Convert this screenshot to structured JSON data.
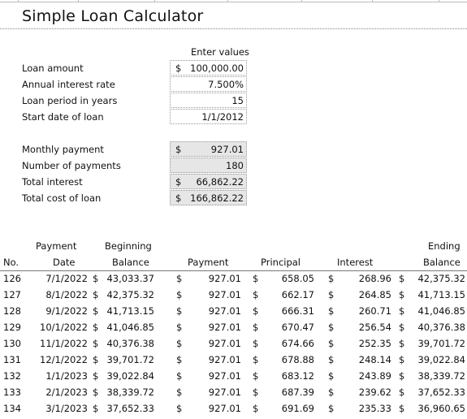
{
  "title": "Simple Loan Calculator",
  "inputs": {
    "header": "Enter values",
    "fields": [
      {
        "label": "Loan amount",
        "currency": "$",
        "value": "100,000.00"
      },
      {
        "label": "Annual interest rate",
        "currency": "",
        "value": "7.500%"
      },
      {
        "label": "Loan period in years",
        "currency": "",
        "value": "15"
      },
      {
        "label": "Start date of loan",
        "currency": "",
        "value": "1/1/2012"
      }
    ]
  },
  "results": {
    "fields": [
      {
        "label": "Monthly payment",
        "currency": "$",
        "value": "927.01"
      },
      {
        "label": "Number of payments",
        "currency": "",
        "value": "180"
      },
      {
        "label": "Total interest",
        "currency": "$",
        "value": "66,862.22"
      },
      {
        "label": "Total cost of loan",
        "currency": "$",
        "value": "166,862.22"
      }
    ]
  },
  "schedule": {
    "headers": {
      "no": "No.",
      "date_top": "Payment",
      "date": "Date",
      "beginning_top": "Beginning",
      "beginning": "Balance",
      "payment": "Payment",
      "principal": "Principal",
      "interest": "Interest",
      "ending_top": "Ending",
      "ending": "Balance"
    },
    "currency": "$",
    "rows": [
      {
        "no": "126",
        "date": "7/1/2022",
        "beginning": "43,033.37",
        "payment": "927.01",
        "principal": "658.05",
        "interest": "268.96",
        "ending": "42,375.32"
      },
      {
        "no": "127",
        "date": "8/1/2022",
        "beginning": "42,375.32",
        "payment": "927.01",
        "principal": "662.17",
        "interest": "264.85",
        "ending": "41,713.15"
      },
      {
        "no": "128",
        "date": "9/1/2022",
        "beginning": "41,713.15",
        "payment": "927.01",
        "principal": "666.31",
        "interest": "260.71",
        "ending": "41,046.85"
      },
      {
        "no": "129",
        "date": "10/1/2022",
        "beginning": "41,046.85",
        "payment": "927.01",
        "principal": "670.47",
        "interest": "256.54",
        "ending": "40,376.38"
      },
      {
        "no": "130",
        "date": "11/1/2022",
        "beginning": "40,376.38",
        "payment": "927.01",
        "principal": "674.66",
        "interest": "252.35",
        "ending": "39,701.72"
      },
      {
        "no": "131",
        "date": "12/1/2022",
        "beginning": "39,701.72",
        "payment": "927.01",
        "principal": "678.88",
        "interest": "248.14",
        "ending": "39,022.84"
      },
      {
        "no": "132",
        "date": "1/1/2023",
        "beginning": "39,022.84",
        "payment": "927.01",
        "principal": "683.12",
        "interest": "243.89",
        "ending": "38,339.72"
      },
      {
        "no": "133",
        "date": "2/1/2023",
        "beginning": "38,339.72",
        "payment": "927.01",
        "principal": "687.39",
        "interest": "239.62",
        "ending": "37,652.33"
      },
      {
        "no": "134",
        "date": "3/1/2023",
        "beginning": "37,652.33",
        "payment": "927.01",
        "principal": "691.69",
        "interest": "235.33",
        "ending": "36,960.65"
      }
    ]
  }
}
